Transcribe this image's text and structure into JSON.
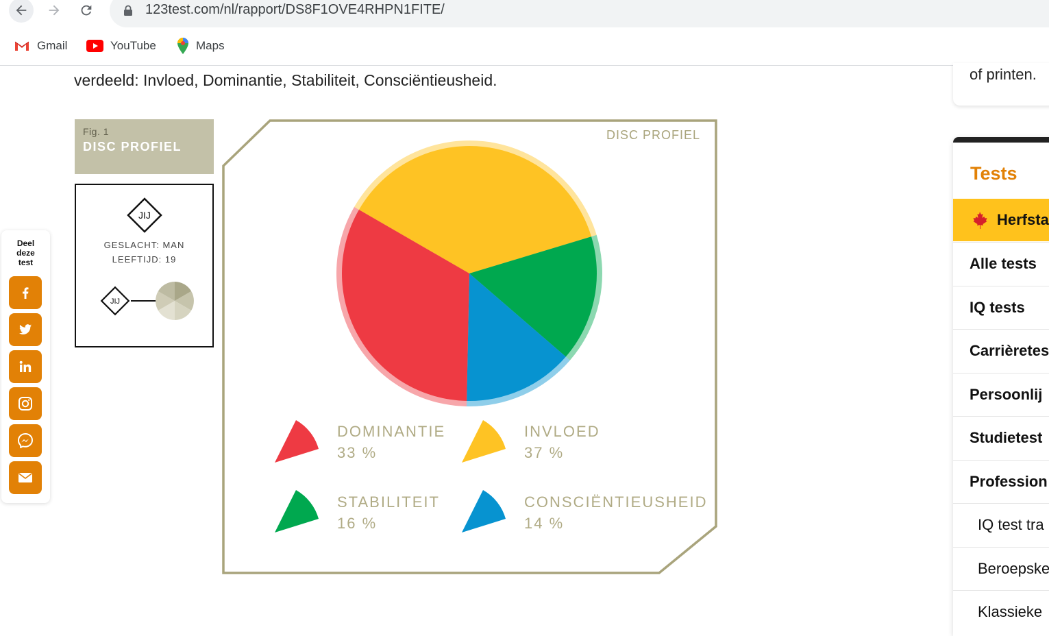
{
  "browser": {
    "url": "123test.com/nl/rapport/DS8F1OVE4RHPN1FITE/",
    "bookmarks": [
      {
        "label": "Gmail",
        "icon": "gmail-icon"
      },
      {
        "label": "YouTube",
        "icon": "youtube-icon"
      },
      {
        "label": "Maps",
        "icon": "maps-icon"
      }
    ]
  },
  "page": {
    "intro_text": "verdeeld: Invloed, Dominantie, Stabiliteit, Consciëntieusheid.",
    "figure": {
      "number": "Fig. 1",
      "title": "DISC PROFIEL"
    },
    "profile_card": {
      "badge": "JIJ",
      "gender": "GESLACHT: MAN",
      "age": "LEEFTIJD: 19",
      "mini_badge": "JIJ"
    }
  },
  "share": {
    "label": "Deel\ndeze\ntest",
    "buttons": [
      {
        "icon": "facebook-icon"
      },
      {
        "icon": "twitter-icon"
      },
      {
        "icon": "linkedin-icon"
      },
      {
        "icon": "instagram-icon"
      },
      {
        "icon": "messenger-icon"
      },
      {
        "icon": "mail-icon"
      }
    ],
    "color": "#e28106"
  },
  "chart_data": {
    "type": "pie",
    "title": "DISC PROFIEL",
    "slices": [
      {
        "name": "DOMINANTIE",
        "value": 33,
        "label": "33 %",
        "color": "#ee3a43"
      },
      {
        "name": "INVLOED",
        "value": 37,
        "label": "37 %",
        "color": "#fec324"
      },
      {
        "name": "STABILITEIT",
        "value": 16,
        "label": "16 %",
        "color": "#00a84f"
      },
      {
        "name": "CONSCIËNTIEUSHEID",
        "value": 14,
        "label": "14 %",
        "color": "#0793d0"
      }
    ]
  },
  "sidebar": {
    "top_card_text": "of printen.",
    "tests_title": "Tests",
    "highlight": {
      "label": "Herfsta",
      "icon": "maple-leaf-icon"
    },
    "items": [
      {
        "label": "Alle tests",
        "bold": true
      },
      {
        "label": "IQ tests",
        "bold": true
      },
      {
        "label": "Carrièretes",
        "bold": true
      },
      {
        "label": "Persoonlij",
        "bold": true
      },
      {
        "label": "Studietest",
        "bold": true
      },
      {
        "label": "Profession",
        "bold": true
      },
      {
        "label": "IQ test tra",
        "bold": false
      },
      {
        "label": "Beroepske",
        "bold": false
      },
      {
        "label": "Klassieke",
        "bold": false
      }
    ],
    "accent_color": "#e28106",
    "highlight_color": "#ffc21c"
  }
}
